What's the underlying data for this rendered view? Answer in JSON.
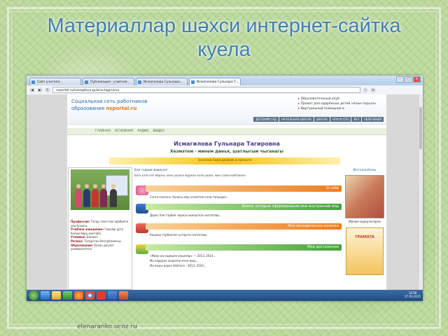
{
  "slide": {
    "title_line1": "Материаллар шәхси интернет-сайтка",
    "title_line2": "куела",
    "caption": "elenaranko.ucoz.ru"
  },
  "browser": {
    "tabs": [
      {
        "label": "Сайт учителя..."
      },
      {
        "label": "Публикация - учителя..."
      },
      {
        "label": "Исмагилова Гульсира..."
      },
      {
        "label": "Исмагилова Гульсира Т..."
      }
    ],
    "url": "nsportal.ru/ismagilova-gulsira-tagirovna",
    "window_buttons": {
      "minimize": "–",
      "maximize": "□",
      "close": "×"
    }
  },
  "site": {
    "logo_line1": "Социальная сеть работников",
    "logo_line2_prefix": "образования ",
    "logo_brand": "nsportal.ru",
    "header_links": [
      "Образовательный клуб",
      "Проект для одарённых детей «Алые паруса»",
      "Виртуальный помощник в"
    ],
    "top_nav": [
      "ДЕТСКИЙ САД",
      "НАЧАЛЬНАЯ ШКОЛА",
      "ШКОЛА",
      "НПО И СПО",
      "ВУЗ",
      "УВЛЕЧЕНИЯ"
    ],
    "sub_nav": [
      "ГЛАВНАЯ",
      "ОСНОВНАЯ",
      "АУДИО",
      "ВИДЕО"
    ],
    "owner_name": "Исмагилова Гульнара Тагировна",
    "page_subtitle": "Хезмэтем - минем дөнья, шатлыгым чыганагы",
    "banner_text": "Заполни Свое резюме в проекте",
    "welcome": "Бэп гырым дэрескэ!",
    "desc_line": "Бэгэ кэлэ гел өйрэнү кенэ уңсенэ журнал кэлэ уңэнэ, мин сэзне кайтэвэнэ",
    "bands": [
      "О себе",
      "Книги, которые сформировали мой внутренний мир",
      "Моя методическая копилка",
      "Мои достижения"
    ],
    "lines": [
      "Сэнга кэлсэнэ, баласы мэр хэзмэтем сэна тапшыра...",
      "Дэрес һэм тэрбия чарасы эшкэрткэн китаплар...",
      "Кешене тэрбиялэп үстергэн китаплар.",
      "«Миңе иң кадерле кешелэр» — 2013, 2014...",
      "Иң кадерле кешелэр өчен жыр...",
      "Иң яхшы дэрес бәйгесе - 2013, 2014..."
    ],
    "left_info": [
      {
        "k": "Профессия:",
        "v": "Татар теле һэм әдәбияте укытучысы"
      },
      {
        "k": "Учебное заведение:",
        "v": "Гомуми урта белем бирү мәктәбе"
      },
      {
        "k": "Ученики:",
        "v": "Шахрат"
      },
      {
        "k": "Регион:",
        "v": "Татарстан Республикасы"
      },
      {
        "k": "Образование:",
        "v": "Казан дәүләт университеты"
      }
    ],
    "right_title": "Фотоальбомы",
    "right_caption": "Минем кадерлелэрем",
    "diploma_text": "ГРАМОТА"
  },
  "taskbar": {
    "icons": [
      "start-icon",
      "ie-icon",
      "folder-icon",
      "player-icon",
      "firefox-icon",
      "chrome-icon",
      "yandex-icon",
      "word-icon",
      "powerpoint-icon"
    ],
    "tray_text": "",
    "time": "16:06",
    "date": "27.03.2015"
  },
  "colors": {
    "title": "#3f7fb3",
    "accent_orange": "#ef7b1c",
    "accent_green": "#45a03b",
    "taskbar": "#1f4a80"
  }
}
